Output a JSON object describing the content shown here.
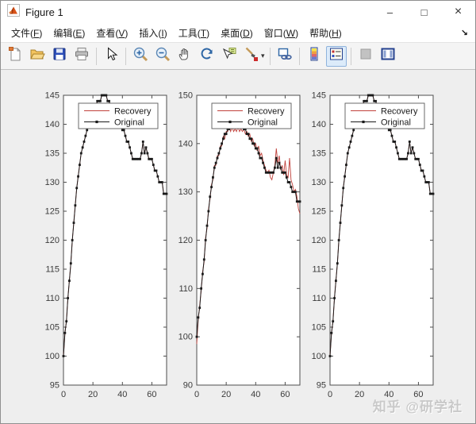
{
  "window": {
    "title": "Figure 1",
    "controls": {
      "minimize": "–",
      "maximize": "□",
      "close": "×"
    }
  },
  "menu_bar": {
    "items": [
      {
        "id": "file",
        "label": "文件(F)"
      },
      {
        "id": "edit",
        "label": "编辑(E)"
      },
      {
        "id": "view",
        "label": "查看(V)"
      },
      {
        "id": "insert",
        "label": "插入(I)"
      },
      {
        "id": "tools",
        "label": "工具(T)"
      },
      {
        "id": "desktop",
        "label": "桌面(D)"
      },
      {
        "id": "window",
        "label": "窗口(W)"
      },
      {
        "id": "help",
        "label": "帮助(H)"
      }
    ],
    "dock_arrow": "↘"
  },
  "toolbar": {
    "groups": [
      [
        "new-figure",
        "open-file",
        "save-figure",
        "print-figure"
      ],
      [
        "edit-pointer"
      ],
      [
        "zoom-in",
        "zoom-out",
        "pan",
        "rotate-3d",
        "data-cursor",
        "brush"
      ],
      [
        "link-plot"
      ],
      [
        "colorbar",
        "legend"
      ],
      [
        "hide-plot-tools",
        "show-plot-tools"
      ]
    ],
    "active": "legend",
    "disabled": [
      "hide-plot-tools"
    ],
    "brush_dropdown_arrow": "▾"
  },
  "watermark": "知乎 @研学社",
  "colors": {
    "recovery_line": "#c0413b",
    "original_line": "#1a1a1a",
    "axes_border": "#4d4d4d",
    "tick_label": "#3b3b3b",
    "legend_border": "#5a5a5a"
  },
  "chart_data": [
    {
      "type": "line",
      "position": "left",
      "title": "",
      "xlabel": "",
      "ylabel": "",
      "xlim": [
        0,
        70
      ],
      "xticks": [
        0,
        20,
        40,
        60
      ],
      "ylim": [
        95,
        145
      ],
      "yticks": [
        95,
        100,
        105,
        110,
        115,
        120,
        125,
        130,
        135,
        140,
        145
      ],
      "grid": false,
      "legend": {
        "entries": [
          "Recovery",
          "Original"
        ],
        "location": "upper-right-of-center"
      },
      "series": [
        {
          "name": "Recovery",
          "color": "#c0413b",
          "marker": "none",
          "values": [
            100,
            104,
            106,
            110,
            113,
            116,
            120,
            123,
            126,
            129,
            131,
            133,
            135,
            136,
            137,
            138,
            139,
            140,
            141,
            142,
            142,
            143,
            143,
            144,
            144,
            144,
            145,
            145,
            145,
            145,
            144,
            144,
            143,
            143,
            142,
            142,
            141,
            141,
            140,
            140,
            139,
            139,
            138,
            137,
            137,
            136,
            135,
            134,
            134,
            134,
            134,
            134,
            134,
            135,
            137,
            135,
            136,
            135,
            134,
            134,
            134,
            133,
            132,
            132,
            131,
            130,
            130,
            130,
            128,
            128,
            128
          ]
        },
        {
          "name": "Original",
          "color": "#1a1a1a",
          "marker": "dot",
          "values": [
            100,
            104,
            106,
            110,
            113,
            116,
            120,
            123,
            126,
            129,
            131,
            133,
            135,
            136,
            137,
            138,
            139,
            140,
            141,
            142,
            142,
            143,
            143,
            144,
            144,
            144,
            145,
            145,
            145,
            145,
            144,
            144,
            143,
            143,
            142,
            142,
            141,
            141,
            140,
            140,
            139,
            139,
            138,
            137,
            137,
            136,
            135,
            134,
            134,
            134,
            134,
            134,
            134,
            135,
            137,
            135,
            136,
            135,
            134,
            134,
            134,
            133,
            132,
            132,
            131,
            130,
            130,
            130,
            128,
            128,
            128
          ]
        }
      ]
    },
    {
      "type": "line",
      "position": "middle",
      "title": "",
      "xlabel": "",
      "ylabel": "",
      "xlim": [
        0,
        70
      ],
      "xticks": [
        0,
        20,
        40,
        60
      ],
      "ylim": [
        90,
        150
      ],
      "yticks": [
        90,
        100,
        110,
        120,
        130,
        140,
        150
      ],
      "grid": false,
      "legend": {
        "entries": [
          "Recovery",
          "Original"
        ],
        "location": "upper-right-of-center"
      },
      "series": [
        {
          "name": "Recovery",
          "color": "#c0413b",
          "marker": "none",
          "values": [
            98.5,
            103.5,
            106.5,
            109.5,
            113.5,
            115.5,
            120.5,
            122.5,
            126.5,
            128.5,
            131.5,
            132.5,
            135.5,
            135.5,
            137.5,
            137.5,
            139.5,
            139.5,
            141.5,
            141,
            142.5,
            142.5,
            143.5,
            142.5,
            143.5,
            142.5,
            143,
            142.5,
            143.5,
            142.5,
            143,
            142.5,
            143,
            142,
            142.5,
            141.5,
            142,
            140.5,
            141,
            139.5,
            140,
            138.5,
            139.5,
            137.5,
            138,
            136.5,
            135.5,
            134.5,
            134,
            134.5,
            133,
            132.5,
            134,
            135.5,
            139,
            136,
            137.5,
            134.5,
            135.5,
            133.5,
            136.5,
            133.5,
            133,
            137,
            132.5,
            131.5,
            130,
            130.5,
            129,
            126.5,
            125.5
          ]
        },
        {
          "name": "Original",
          "color": "#1a1a1a",
          "marker": "dot",
          "values": [
            100,
            104,
            106,
            110,
            113,
            116,
            120,
            123,
            126,
            129,
            131,
            133,
            135,
            136,
            137,
            138,
            139,
            140,
            141,
            142,
            142,
            143,
            143,
            144,
            144,
            144,
            145,
            145,
            145,
            145,
            144,
            144,
            143,
            143,
            142,
            142,
            141,
            141,
            140,
            140,
            139,
            139,
            138,
            137,
            137,
            136,
            135,
            134,
            134,
            134,
            134,
            134,
            134,
            135,
            137,
            135,
            136,
            135,
            134,
            134,
            134,
            133,
            132,
            132,
            131,
            130,
            130,
            130,
            128,
            128,
            128
          ]
        }
      ]
    },
    {
      "type": "line",
      "position": "right",
      "title": "",
      "xlabel": "",
      "ylabel": "",
      "xlim": [
        0,
        70
      ],
      "xticks": [
        0,
        20,
        40,
        60
      ],
      "ylim": [
        95,
        145
      ],
      "yticks": [
        95,
        100,
        105,
        110,
        115,
        120,
        125,
        130,
        135,
        140,
        145
      ],
      "grid": false,
      "legend": {
        "entries": [
          "Recovery",
          "Original"
        ],
        "location": "upper-right-of-center"
      },
      "series": [
        {
          "name": "Recovery",
          "color": "#c0413b",
          "marker": "none",
          "values": [
            100,
            104,
            106,
            110,
            113,
            116,
            120,
            123,
            126,
            129,
            131,
            133,
            135,
            136,
            137,
            138,
            139,
            140,
            141,
            142,
            142,
            143,
            143,
            144,
            144,
            144,
            145,
            145,
            145,
            145,
            144,
            144,
            143,
            143,
            142,
            142,
            141,
            141,
            140,
            140,
            139,
            139,
            138,
            137,
            137,
            136,
            135,
            134,
            134,
            134,
            134,
            134,
            134,
            135,
            137,
            135,
            136,
            135,
            134,
            134,
            134,
            133,
            132,
            132,
            131,
            130,
            130,
            130,
            128,
            128,
            128
          ]
        },
        {
          "name": "Original",
          "color": "#1a1a1a",
          "marker": "dot",
          "values": [
            100,
            104,
            106,
            110,
            113,
            116,
            120,
            123,
            126,
            129,
            131,
            133,
            135,
            136,
            137,
            138,
            139,
            140,
            141,
            142,
            142,
            143,
            143,
            144,
            144,
            144,
            145,
            145,
            145,
            145,
            144,
            144,
            143,
            143,
            142,
            142,
            141,
            141,
            140,
            140,
            139,
            139,
            138,
            137,
            137,
            136,
            135,
            134,
            134,
            134,
            134,
            134,
            134,
            135,
            137,
            135,
            136,
            135,
            134,
            134,
            134,
            133,
            132,
            132,
            131,
            130,
            130,
            130,
            128,
            128,
            128
          ]
        }
      ]
    }
  ]
}
